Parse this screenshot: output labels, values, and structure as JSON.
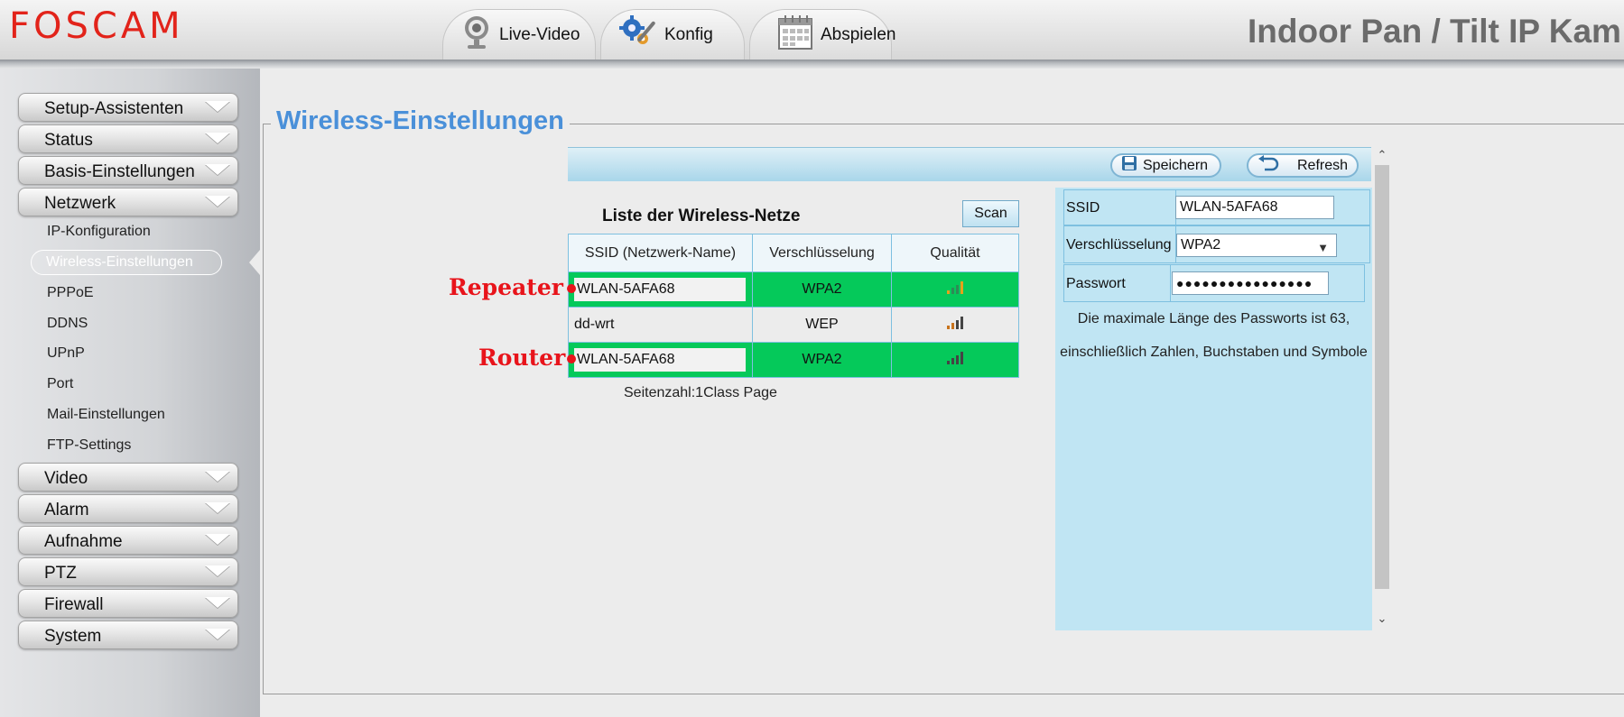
{
  "header": {
    "logo": "FOSCAM",
    "device_title": "Indoor Pan / Tilt IP Kam",
    "tabs": [
      {
        "label": "Live-Video",
        "icon": "webcam-icon"
      },
      {
        "label": "Konfig",
        "icon": "gears-tools-icon"
      },
      {
        "label": "Abspielen",
        "icon": "calendar-icon"
      }
    ]
  },
  "sidebar": {
    "menu": [
      {
        "label": "Setup-Assistenten"
      },
      {
        "label": "Status"
      },
      {
        "label": "Basis-Einstellungen"
      },
      {
        "label": "Netzwerk"
      }
    ],
    "netzwerk_items": [
      "IP-Konfiguration",
      "Wireless-Einstellungen",
      "PPPoE",
      "DDNS",
      "UPnP",
      "Port",
      "Mail-Einstellungen",
      "FTP-Settings"
    ],
    "menu_after": [
      {
        "label": "Video"
      },
      {
        "label": "Alarm"
      },
      {
        "label": "Aufnahme"
      },
      {
        "label": "PTZ"
      },
      {
        "label": "Firewall"
      },
      {
        "label": "System"
      }
    ]
  },
  "main": {
    "title": "Wireless-Einstellungen",
    "toolbar": {
      "save_label": "Speichern",
      "refresh_label": "Refresh"
    },
    "list": {
      "title": "Liste der Wireless-Netze",
      "scan_label": "Scan",
      "columns": [
        "SSID (Netzwerk-Name)",
        "Verschlüsselung",
        "Qualität"
      ],
      "rows": [
        {
          "ssid": "WLAN-5AFA68",
          "encryption": "WPA2",
          "signal": 4,
          "highlighted": true
        },
        {
          "ssid": "dd-wrt",
          "encryption": "WEP",
          "signal": 4,
          "highlighted": false
        },
        {
          "ssid": "WLAN-5AFA68",
          "encryption": "WPA2",
          "signal": 4,
          "highlighted": true
        }
      ],
      "page_count": "Seitenzahl:1Class Page"
    },
    "annotations": {
      "repeater": "Repeater",
      "router": "Router"
    },
    "form": {
      "ssid_label": "SSID",
      "ssid_value": "WLAN-5AFA68",
      "encryption_label": "Verschlüsselung",
      "encryption_value": "WPA2",
      "password_label": "Passwort",
      "password_value": "●●●●●●●●●●●●●●●●",
      "hint_line1": "Die maximale Länge des Passworts ist 63,",
      "hint_line2": "einschließlich Zahlen, Buchstaben und Symbole"
    }
  },
  "colors": {
    "logo_red": "#e2231a",
    "title_blue": "#4a90d9",
    "highlight_green": "#05c95a",
    "annotation_red": "#e8141b",
    "panel_blue": "#c0e5f3"
  }
}
